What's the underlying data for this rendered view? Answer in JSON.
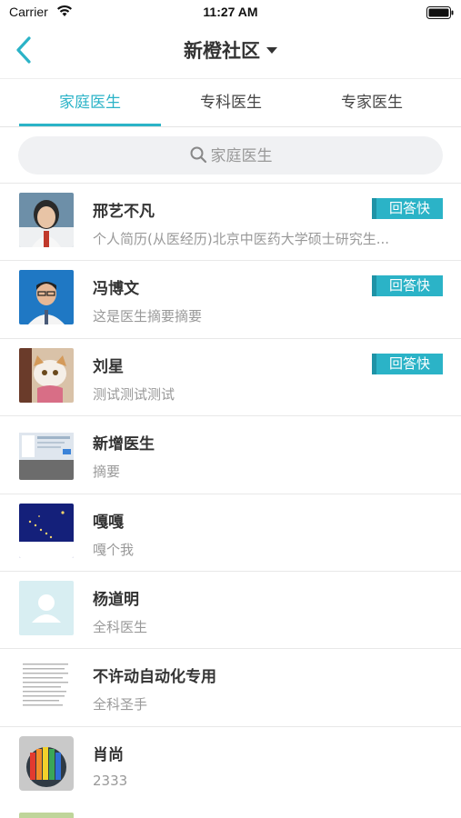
{
  "status_bar": {
    "carrier": "Carrier",
    "time": "11:27 AM"
  },
  "nav": {
    "title": "新橙社区"
  },
  "tabs": [
    {
      "label": "家庭医生",
      "active": true
    },
    {
      "label": "专科医生",
      "active": false
    },
    {
      "label": "专家医生",
      "active": false
    }
  ],
  "search": {
    "placeholder": "家庭医生"
  },
  "doctors": [
    {
      "name": "邢艺不凡",
      "summary": "个人简历(从医经历)北京中医药大学硕士研究生...",
      "badge": "回答快",
      "avatar": "doctor-woman-photo"
    },
    {
      "name": "冯博文",
      "summary": "这是医生摘要摘要",
      "badge": "回答快",
      "avatar": "doctor-man-photo"
    },
    {
      "name": "刘星",
      "summary": "测试测试测试",
      "badge": "回答快",
      "avatar": "cat-photo"
    },
    {
      "name": "新增医生",
      "summary": "摘要",
      "badge": "",
      "avatar": "screenshot-thumbnail"
    },
    {
      "name": "嘎嘎",
      "summary": "嘎个我",
      "badge": "",
      "avatar": "night-sky-photo"
    },
    {
      "name": "杨道明",
      "summary": "全科医生",
      "badge": "",
      "avatar": "default-person-avatar"
    },
    {
      "name": "不许动自动化专用",
      "summary": "全科圣手",
      "badge": "",
      "avatar": "text-document-thumbnail"
    },
    {
      "name": "肖尚",
      "summary": "2333",
      "badge": "",
      "avatar": "colored-pencils-photo"
    }
  ],
  "colors": {
    "accent": "#2bb3c7",
    "badge_edge": "#1e93a6",
    "text_primary": "#333333",
    "text_secondary": "#999999"
  }
}
